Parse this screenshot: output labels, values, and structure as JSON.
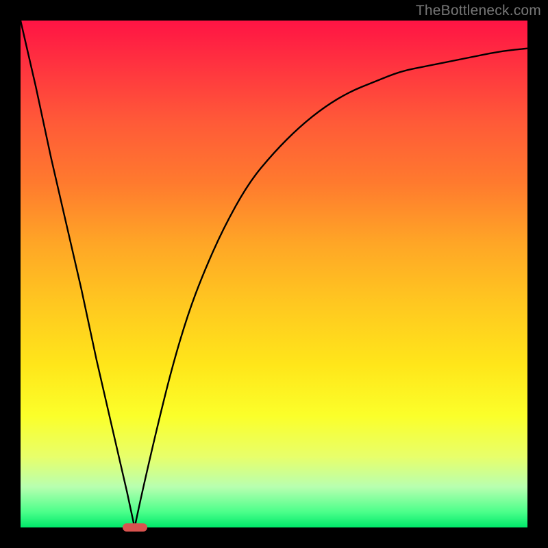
{
  "watermark": "TheBottleneck.com",
  "marker": {
    "color": "#d9534f",
    "x_fraction": 0.225
  },
  "chart_data": {
    "type": "line",
    "title": "",
    "xlabel": "",
    "ylabel": "",
    "xlim": [
      0,
      1
    ],
    "ylim": [
      0,
      1
    ],
    "x": [
      0.0,
      0.03,
      0.06,
      0.09,
      0.12,
      0.15,
      0.18,
      0.21,
      0.225,
      0.24,
      0.27,
      0.3,
      0.33,
      0.36,
      0.4,
      0.45,
      0.5,
      0.55,
      0.6,
      0.65,
      0.7,
      0.75,
      0.8,
      0.85,
      0.9,
      0.95,
      1.0
    ],
    "values": [
      1.0,
      0.87,
      0.73,
      0.6,
      0.47,
      0.33,
      0.2,
      0.07,
      0.0,
      0.07,
      0.2,
      0.32,
      0.42,
      0.5,
      0.59,
      0.68,
      0.74,
      0.79,
      0.83,
      0.86,
      0.88,
      0.9,
      0.91,
      0.92,
      0.93,
      0.94,
      0.945
    ],
    "annotations": [
      "TheBottleneck.com"
    ],
    "legend": []
  }
}
